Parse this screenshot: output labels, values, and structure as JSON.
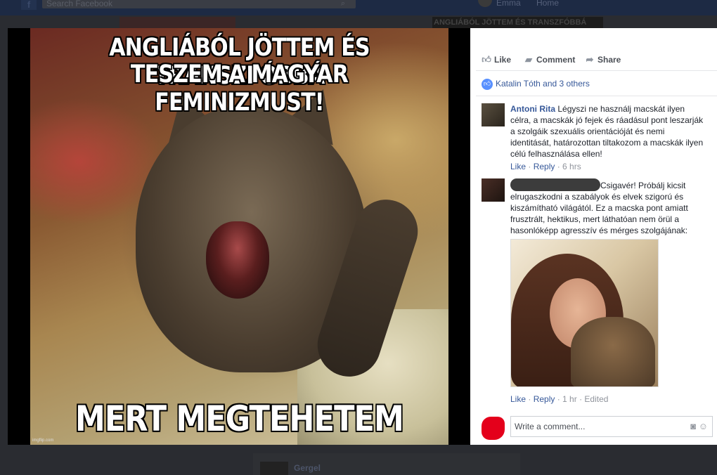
{
  "topbar": {
    "search_placeholder": "Search Facebook",
    "user_name": "Emma",
    "home_label": "Home"
  },
  "background": {
    "strip_text": "ANGLIÁBÓL JÖTTEM ÉS TRANSZFÓBBÁ",
    "below_name": "Gergel"
  },
  "meme": {
    "top_line1": "ANGLIÁBÓL JÖTTEM ÉS TRANSZFÓBBÁ",
    "top_line2": "TESZEM A MAGYAR FEMINIZMUST!",
    "bottom_line": "MERT MEGTEHETEM ...",
    "watermark": "imgflip.com"
  },
  "actions": {
    "like": "Like",
    "comment": "Comment",
    "share": "Share"
  },
  "likes": {
    "text": "Katalin Tóth and 3 others"
  },
  "comments": [
    {
      "author": "Antoni Rita",
      "text": "Légyszi ne használj macskát ilyen célra, a macskák jó fejek és ráadásul pont leszarják a szolgáik szexuális orientációját és nemi identitását, határozottan tiltakozom a macskák ilyen célú felhasználása ellen!",
      "like": "Like",
      "reply": "Reply",
      "time": "6 hrs"
    },
    {
      "text": "Csigavér! Próbálj kicsit elrugaszkodni a szabályok és elvek szigorú és kiszámítható világától. Ez a macska pont amiatt frusztrált, hektikus, mert láthatóan nem örül a hasonlóképp agresszív és mérges szolgájának:",
      "like": "Like",
      "reply": "Reply",
      "time": "1 hr",
      "edited": "Edited"
    }
  ],
  "composer": {
    "placeholder": "Write a comment..."
  },
  "icons": {
    "like": "thumbs-up-icon",
    "comment": "speech-bubble-icon",
    "share": "share-arrow-icon",
    "camera": "camera-icon",
    "emoji": "smiley-icon"
  },
  "colors": {
    "link": "#365899",
    "badge": "#5890ff",
    "redaction": "#e4001b"
  }
}
